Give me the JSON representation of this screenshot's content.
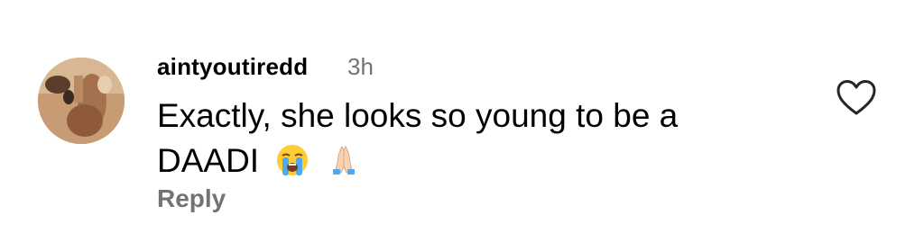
{
  "comment": {
    "username": "aintyoutiredd",
    "timestamp": "3h",
    "text_line1": "Exactly, she looks so young to be a",
    "text_line2": "DAADI",
    "emojis": [
      "loudly-crying-face-emoji",
      "folded-hands-emoji"
    ],
    "reply_label": "Reply",
    "like_icon": "heart-outline-icon"
  },
  "colors": {
    "text_primary": "#000000",
    "text_secondary": "#737373",
    "background": "#ffffff",
    "heart_stroke": "#262626"
  }
}
